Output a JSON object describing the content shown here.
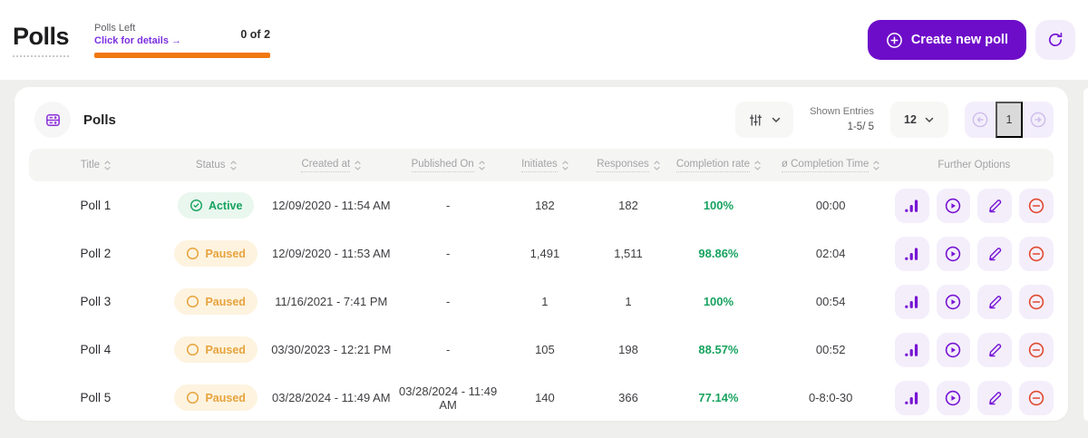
{
  "colors": {
    "primary": "#6e0dc9",
    "accent": "#7714d4",
    "link": "#7c2fe0",
    "progress": "#f1770f",
    "success": "#17a35f",
    "warning": "#e7a33c",
    "danger": "#e0492e"
  },
  "page": {
    "title": "Polls",
    "polls_left": {
      "label": "Polls Left",
      "link": "Click for details →",
      "count": "0 of 2",
      "progress_percent": 100
    },
    "create_label": "Create new poll",
    "icons": {
      "create": "plus-circle",
      "refresh": "refresh-arrow"
    }
  },
  "card": {
    "title": "Polls",
    "icon": "poll-rows",
    "filter_icon": "sliders",
    "shown_entries_label": "Shown Entries",
    "shown_entries_value": "1-5/ 5",
    "page_size": "12",
    "current_page": "1",
    "pagination_icons": [
      "arrow-left-circle",
      "arrow-right-circle"
    ]
  },
  "table": {
    "columns": [
      {
        "label": "Title",
        "sortable": true,
        "underlined": false
      },
      {
        "label": "Status",
        "sortable": true,
        "underlined": false
      },
      {
        "label": "Created at",
        "sortable": true,
        "underlined": true
      },
      {
        "label": "Published On",
        "sortable": true,
        "underlined": true
      },
      {
        "label": "Initiates",
        "sortable": true,
        "underlined": true
      },
      {
        "label": "Responses",
        "sortable": true,
        "underlined": true
      },
      {
        "label": "Completion rate",
        "sortable": true,
        "underlined": true
      },
      {
        "label": "ø Completion Time",
        "sortable": true,
        "underlined": true
      },
      {
        "label": "Further Options",
        "sortable": false,
        "underlined": false
      }
    ],
    "row_actions": [
      "bar-chart-statistics",
      "play-circle",
      "edit-pencil",
      "remove-circle"
    ],
    "rows": [
      {
        "title": "Poll 1",
        "status": "Active",
        "status_type": "active",
        "created_at": "12/09/2020 - 11:54 AM",
        "published_on": "-",
        "initiates": "182",
        "responses": "182",
        "completion_rate": "100%",
        "completion_time": "00:00"
      },
      {
        "title": "Poll 2",
        "status": "Paused",
        "status_type": "paused",
        "created_at": "12/09/2020 - 11:53 AM",
        "published_on": "-",
        "initiates": "1,491",
        "responses": "1,511",
        "completion_rate": "98.86%",
        "completion_time": "02:04"
      },
      {
        "title": "Poll 3",
        "status": "Paused",
        "status_type": "paused",
        "created_at": "11/16/2021 - 7:41 PM",
        "published_on": "-",
        "initiates": "1",
        "responses": "1",
        "completion_rate": "100%",
        "completion_time": "00:54"
      },
      {
        "title": "Poll 4",
        "status": "Paused",
        "status_type": "paused",
        "created_at": "03/30/2023 - 12:21 PM",
        "published_on": "-",
        "initiates": "105",
        "responses": "198",
        "completion_rate": "88.57%",
        "completion_time": "00:52"
      },
      {
        "title": "Poll 5",
        "status": "Paused",
        "status_type": "paused",
        "created_at": "03/28/2024 - 11:49 AM",
        "published_on": "03/28/2024 - 11:49 AM",
        "initiates": "140",
        "responses": "366",
        "completion_rate": "77.14%",
        "completion_time": "0-8:0-30"
      }
    ]
  }
}
